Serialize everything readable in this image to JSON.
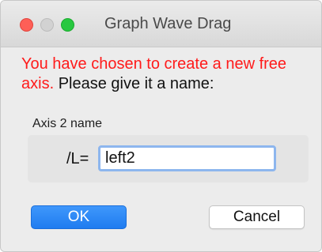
{
  "window": {
    "title": "Graph Wave Drag"
  },
  "message": {
    "warning": "You have chosen to create a new free axis.",
    "instruction": "Please give it a name:"
  },
  "axis_group": {
    "label": "Axis 2 name",
    "prefix": "/L=",
    "value": "left2"
  },
  "buttons": {
    "ok": "OK",
    "cancel": "Cancel"
  },
  "colors": {
    "warning_text": "#ff1a1a",
    "default_button": "#1f7cf0",
    "focus_ring": "#8db6ee",
    "close_light": "#fe5f57",
    "zoom_light": "#28c840"
  }
}
